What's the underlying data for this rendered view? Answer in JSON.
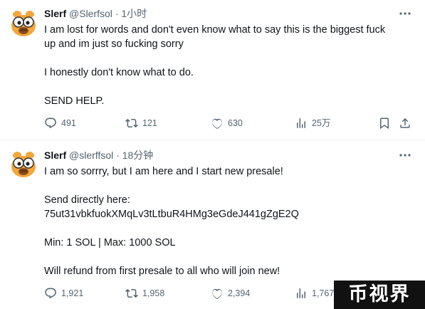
{
  "tweets": [
    {
      "name": "Slerf",
      "handle": "@Slerfsol",
      "separator": "·",
      "time": "1小时",
      "lines": [
        "I am lost for words and don't even know what to say this is the biggest fuck",
        "up and im just so fucking sorry",
        "",
        "I honestly don't know what to do.",
        "",
        "SEND HELP."
      ],
      "stats": {
        "replies": "491",
        "reposts": "121",
        "likes": "630",
        "views": "25万"
      }
    },
    {
      "name": "Slerf",
      "handle": "@slerffsol",
      "separator": "·",
      "time": "18分钟",
      "lines": [
        "I am so sorrry, but I am here and I start new presale!",
        "",
        "Send directly here:",
        "75ut31vbkfuokXMqLv3tLtbuR4HMg3eGdeJ441gZgE2Q",
        "",
        "Min: 1 SOL | Max: 1000 SOL",
        "",
        "Will refund from first presale to all who will join new!"
      ],
      "stats": {
        "replies": "1,921",
        "reposts": "1,958",
        "likes": "2,394",
        "views": "1,767"
      }
    }
  ],
  "watermark": "币视界",
  "icons": {
    "reply": "reply-icon",
    "repost": "repost-icon",
    "like": "like-icon",
    "views": "views-icon",
    "bookmark": "bookmark-icon",
    "share": "share-icon",
    "more": "more-icon"
  },
  "colors": {
    "text": "#0f1419",
    "secondary": "#536471",
    "divider": "#eff3f4"
  }
}
